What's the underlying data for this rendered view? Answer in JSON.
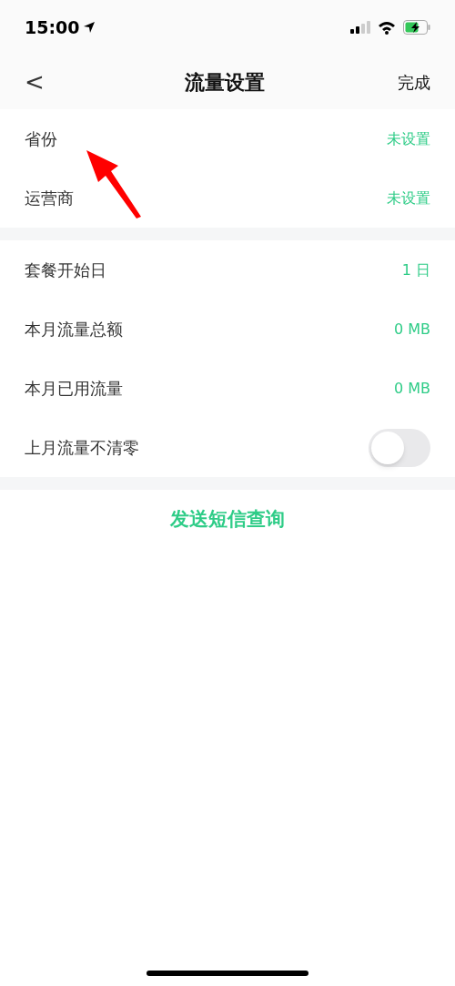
{
  "status_bar": {
    "time": "15:00"
  },
  "nav": {
    "back": "<",
    "title": "流量设置",
    "done": "完成"
  },
  "groups": [
    {
      "rows": [
        {
          "kind": "value",
          "label": "省份",
          "value": "未设置"
        },
        {
          "kind": "value",
          "label": "运营商",
          "value": "未设置"
        }
      ]
    },
    {
      "rows": [
        {
          "kind": "value",
          "label": "套餐开始日",
          "value": "1 日"
        },
        {
          "kind": "value",
          "label": "本月流量总额",
          "value": "0 MB"
        },
        {
          "kind": "value",
          "label": "本月已用流量",
          "value": "0 MB"
        },
        {
          "kind": "toggle",
          "label": "上月流量不清零",
          "on": false
        }
      ]
    }
  ],
  "action": "发送短信查询"
}
